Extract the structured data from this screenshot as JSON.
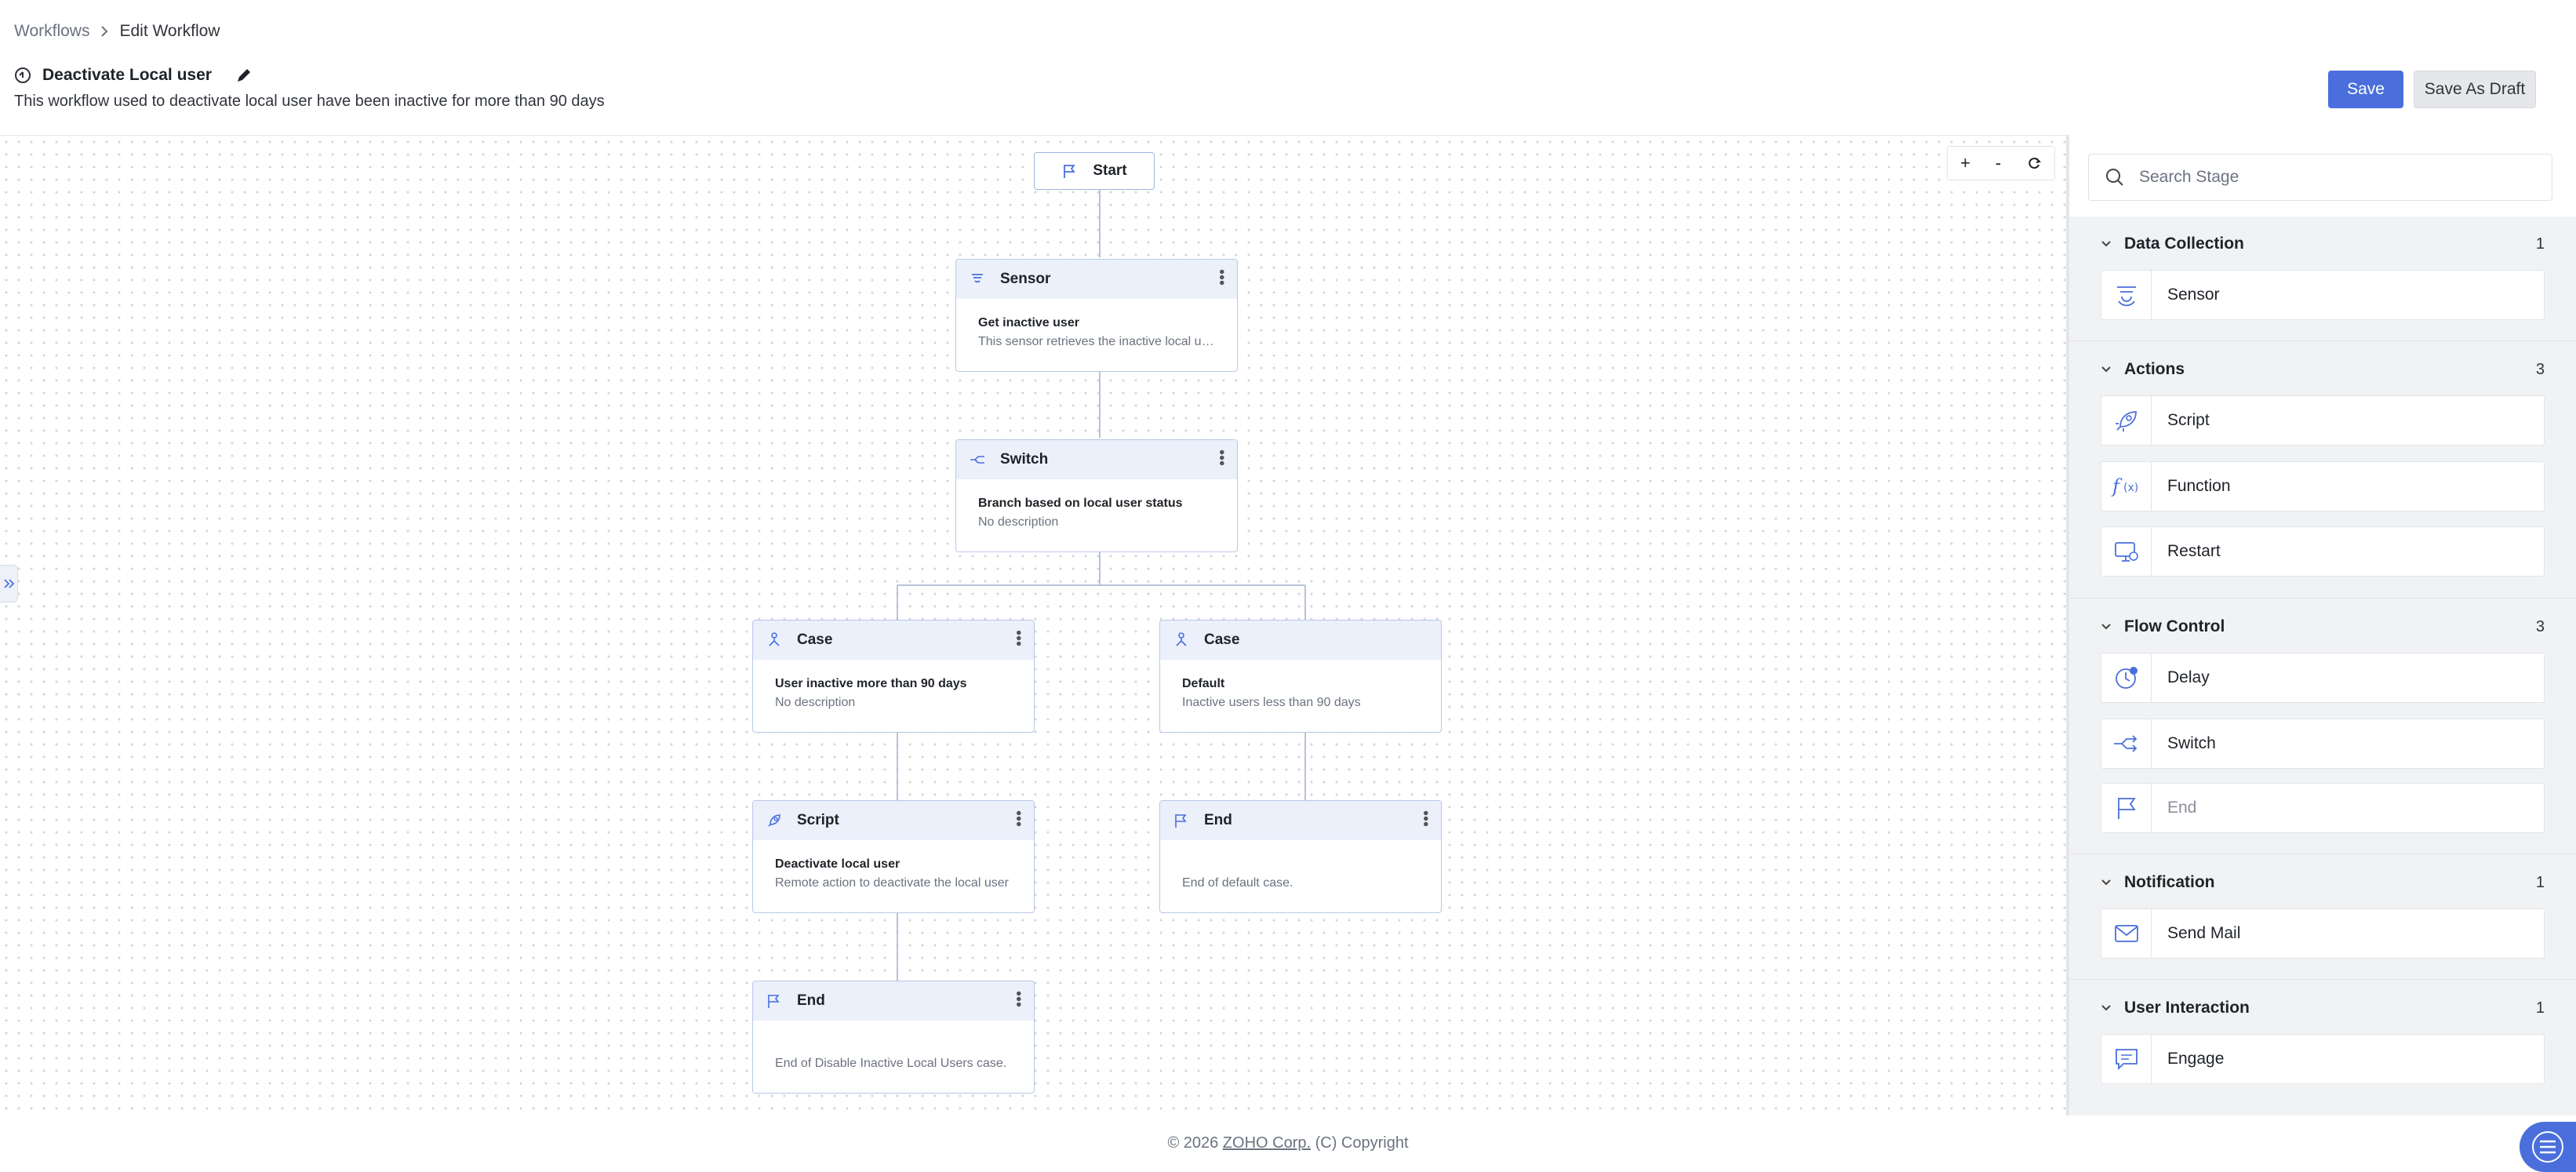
{
  "breadcrumb": {
    "parent": "Workflows",
    "separator": ">",
    "current": "Edit Workflow"
  },
  "workflow": {
    "title": "Deactivate Local user",
    "description": "This workflow used to deactivate local user have been inactive for more than 90 days"
  },
  "actions": {
    "save": "Save",
    "save_draft": "Save As Draft"
  },
  "zoom": {
    "in": "+",
    "out": "-"
  },
  "canvas": {
    "start": "Start",
    "nodes": {
      "sensor": {
        "type": "Sensor",
        "name": "Get inactive user",
        "desc": "This sensor retrieves the inactive local us..."
      },
      "switch": {
        "type": "Switch",
        "name": "Branch based on local user status",
        "desc": "No description"
      },
      "case1": {
        "type": "Case",
        "name": "User inactive more than 90 days",
        "desc": "No description"
      },
      "case2": {
        "type": "Case",
        "name": "Default",
        "desc": "Inactive users less than 90 days"
      },
      "script": {
        "type": "Script",
        "name": "Deactivate local user",
        "desc": "Remote action to deactivate the local user"
      },
      "end1": {
        "type": "End",
        "desc": "End of Disable Inactive Local Users case."
      },
      "end2": {
        "type": "End",
        "desc": "End of default case."
      }
    }
  },
  "panel": {
    "search_placeholder": "Search Stage",
    "categories": [
      {
        "name": "Data Collection",
        "count": "1",
        "items": [
          {
            "label": "Sensor",
            "icon": "sensor-icon"
          }
        ]
      },
      {
        "name": "Actions",
        "count": "3",
        "items": [
          {
            "label": "Script",
            "icon": "rocket-icon"
          },
          {
            "label": "Function",
            "icon": "function-icon"
          },
          {
            "label": "Restart",
            "icon": "monitor-restart-icon"
          }
        ]
      },
      {
        "name": "Flow Control",
        "count": "3",
        "items": [
          {
            "label": "Delay",
            "icon": "clock-icon"
          },
          {
            "label": "Switch",
            "icon": "switch-icon"
          },
          {
            "label": "End",
            "icon": "flag-icon"
          }
        ]
      },
      {
        "name": "Notification",
        "count": "1",
        "items": [
          {
            "label": "Send Mail",
            "icon": "mail-icon"
          }
        ]
      },
      {
        "name": "User Interaction",
        "count": "1",
        "items": [
          {
            "label": "Engage",
            "icon": "chat-icon"
          }
        ]
      }
    ]
  },
  "footer": {
    "copyright": "© 2026 ",
    "company": "ZOHO Corp.",
    "suffix": " (C) Copyright"
  },
  "colors": {
    "accent": "#4a6fdc",
    "node_header": "#ebf0fb",
    "node_border": "#b9c8e8"
  }
}
